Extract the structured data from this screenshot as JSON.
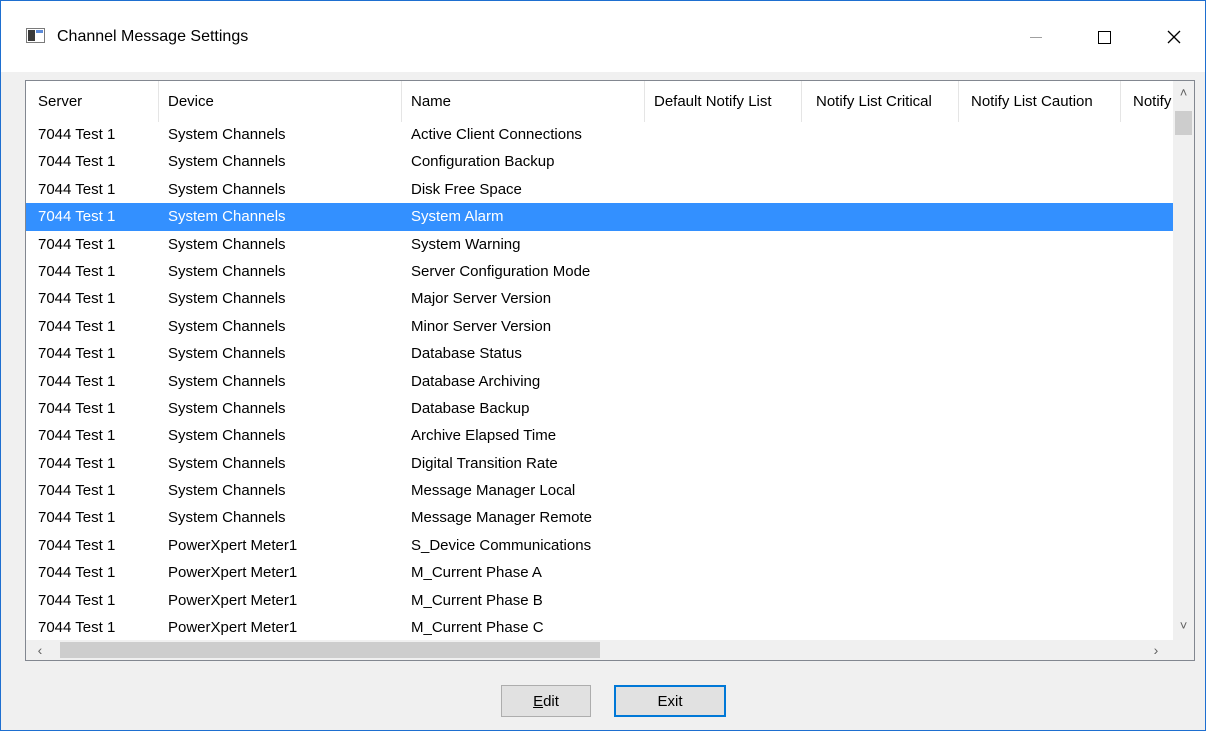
{
  "window": {
    "title": "Channel Message Settings",
    "icon": "app-window-icon"
  },
  "columns": [
    "Server",
    "Device",
    "Name",
    "Default Notify List",
    "Notify List Critical",
    "Notify List Caution",
    "Notify"
  ],
  "rows": [
    {
      "server": "7044 Test 1",
      "device": "System Channels",
      "name": "Active Client Connections"
    },
    {
      "server": "7044 Test 1",
      "device": "System Channels",
      "name": "Configuration Backup"
    },
    {
      "server": "7044 Test 1",
      "device": "System Channels",
      "name": "Disk Free Space"
    },
    {
      "server": "7044 Test 1",
      "device": "System Channels",
      "name": "System Alarm"
    },
    {
      "server": "7044 Test 1",
      "device": "System Channels",
      "name": "System Warning"
    },
    {
      "server": "7044 Test 1",
      "device": "System Channels",
      "name": "Server Configuration Mode"
    },
    {
      "server": "7044 Test 1",
      "device": "System Channels",
      "name": "Major Server Version"
    },
    {
      "server": "7044 Test 1",
      "device": "System Channels",
      "name": "Minor Server Version"
    },
    {
      "server": "7044 Test 1",
      "device": "System Channels",
      "name": "Database Status"
    },
    {
      "server": "7044 Test 1",
      "device": "System Channels",
      "name": "Database Archiving"
    },
    {
      "server": "7044 Test 1",
      "device": "System Channels",
      "name": "Database Backup"
    },
    {
      "server": "7044 Test 1",
      "device": "System Channels",
      "name": "Archive Elapsed Time"
    },
    {
      "server": "7044 Test 1",
      "device": "System Channels",
      "name": "Digital Transition Rate"
    },
    {
      "server": "7044 Test 1",
      "device": "System Channels",
      "name": "Message Manager Local"
    },
    {
      "server": "7044 Test 1",
      "device": "System Channels",
      "name": "Message Manager Remote"
    },
    {
      "server": "7044 Test 1",
      "device": "PowerXpert Meter1",
      "name": "S_Device Communications"
    },
    {
      "server": "7044 Test 1",
      "device": "PowerXpert Meter1",
      "name": "M_Current Phase A"
    },
    {
      "server": "7044 Test 1",
      "device": "PowerXpert Meter1",
      "name": "M_Current Phase B"
    },
    {
      "server": "7044 Test 1",
      "device": "PowerXpert Meter1",
      "name": "M_Current Phase C"
    }
  ],
  "selected_index": 3,
  "buttons": {
    "edit_first": "E",
    "edit_rest": "dit",
    "exit": "Exit"
  },
  "colors": {
    "selection": "#3390ff",
    "border": "#1e6fd0"
  }
}
